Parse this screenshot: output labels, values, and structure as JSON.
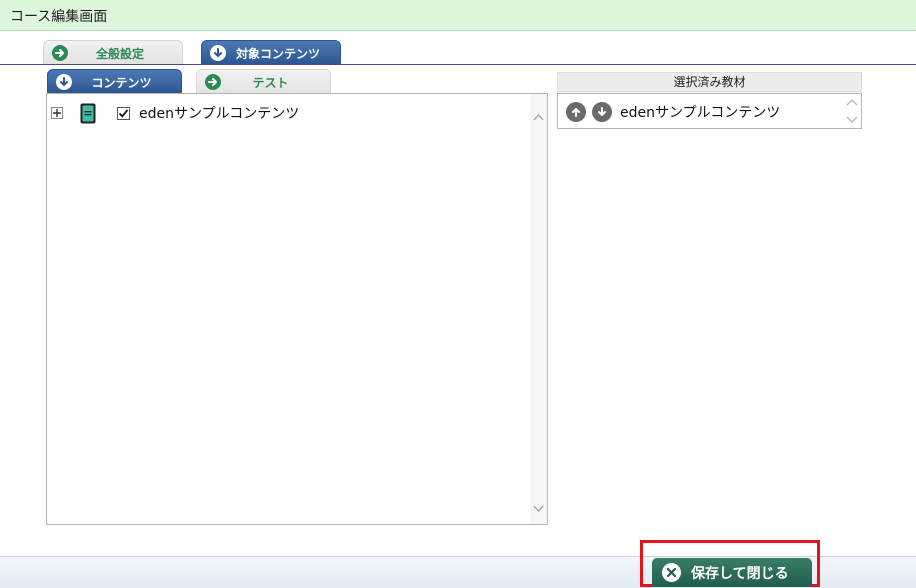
{
  "header": {
    "title": "コース編集画面"
  },
  "top_tabs": [
    {
      "label": "全般設定",
      "icon": "arrow-right-circle-icon",
      "active": false
    },
    {
      "label": "対象コンテンツ",
      "icon": "arrow-down-circle-icon",
      "active": true
    }
  ],
  "sub_tabs": [
    {
      "label": "コンテンツ",
      "icon": "arrow-down-circle-icon",
      "active": true
    },
    {
      "label": "テスト",
      "icon": "arrow-right-circle-icon",
      "active": false
    }
  ],
  "content_tree": {
    "items": [
      {
        "label": "edenサンプルコンテンツ",
        "checked": true,
        "expander": "plus",
        "icon": "book-icon"
      }
    ]
  },
  "selected_panel": {
    "header": "選択済み教材",
    "items": [
      {
        "label": "edenサンプルコンテンツ"
      }
    ]
  },
  "footer": {
    "save_close_label": "保存して閉じる"
  },
  "colors": {
    "header_bg": "#ddf7dc",
    "tab_active": "#2c5590",
    "tab_inactive_text": "#2e8a55",
    "save_button": "#1f5e4c",
    "highlight_box": "#e0141a"
  }
}
